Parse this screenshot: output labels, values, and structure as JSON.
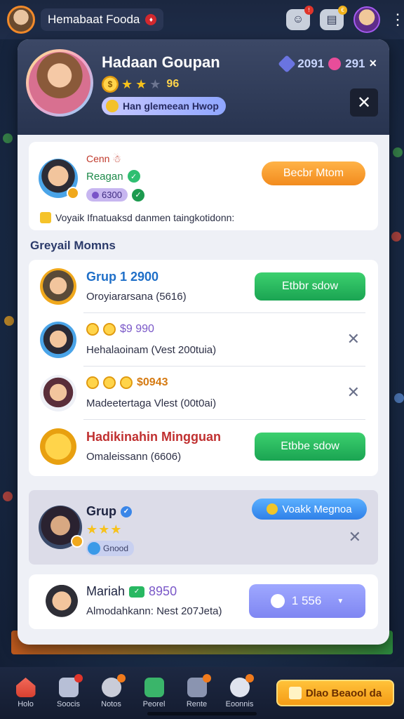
{
  "topbar": {
    "title": "Hemabaat Fooda",
    "flag": "♦",
    "btn1_badge": "!",
    "btn2_badge": "€"
  },
  "header": {
    "name": "Hadaan Goupan",
    "level": "96",
    "stars": 2,
    "chip": "Han glemeean Hwop",
    "gems": "2091",
    "hearts": "291",
    "close_x": "×"
  },
  "invite": {
    "line1": "Cenn ☃",
    "line2": "Reagan",
    "pill": "6300",
    "button": "Becbr Mtom",
    "note": "Voyaik Ifnatuaksd danmen taingkotidonn:"
  },
  "section_title": "Greyail Momns",
  "rows": [
    {
      "title": "Grup 1 2900",
      "sub": "Oroyiararsana (5616)",
      "action": "Etbbr sdow"
    },
    {
      "title_prefix": "",
      "title_val": "$9 990",
      "sub": "Hehalaoinam (Vest 200tuia)"
    },
    {
      "title_val": "$0943",
      "sub": "Madeetertaga Vlest (00t0ai)"
    },
    {
      "title": "Hadikinahin Mingguan",
      "sub": "Omaleissann (6606)",
      "action": "Etbbe sdow"
    }
  ],
  "group": {
    "name": "Grup",
    "chip": "Gnood",
    "action": "Voakk Megnoa"
  },
  "user": {
    "name": "Mariah",
    "num": "8950",
    "sub": "Almodahkann: Nest 207Jeta)",
    "action": "1 556"
  },
  "nav": {
    "items": [
      "Holo",
      "Soocis",
      "Notos",
      "Peorel",
      "Rente",
      "Eoonnis"
    ],
    "cta": "Dlao Beaool da"
  }
}
